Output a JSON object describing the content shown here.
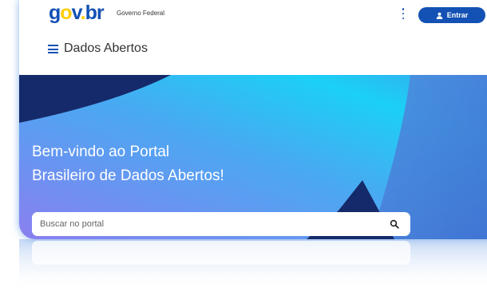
{
  "header": {
    "logo_text": "gov.br",
    "gov_label": "Governo Federal",
    "more_menu_icon": "vertical-dots-icon",
    "login_button": {
      "label": "Entrar",
      "icon": "user-icon"
    }
  },
  "nav": {
    "menu_icon": "hamburger-icon",
    "site_title": "Dados Abertos"
  },
  "hero": {
    "title_line1": "Bem-vindo ao Portal",
    "title_line2": "Brasileiro de Dados Abertos!"
  },
  "search": {
    "placeholder": "Buscar no portal",
    "icon": "search-icon"
  },
  "colors": {
    "brand_blue": "#1351b4",
    "brand_yellow": "#ffcd07",
    "hero_gradient_start": "#8a7ff0",
    "hero_gradient_end": "#1bd0f5",
    "hero_dark": "#152a6a"
  }
}
